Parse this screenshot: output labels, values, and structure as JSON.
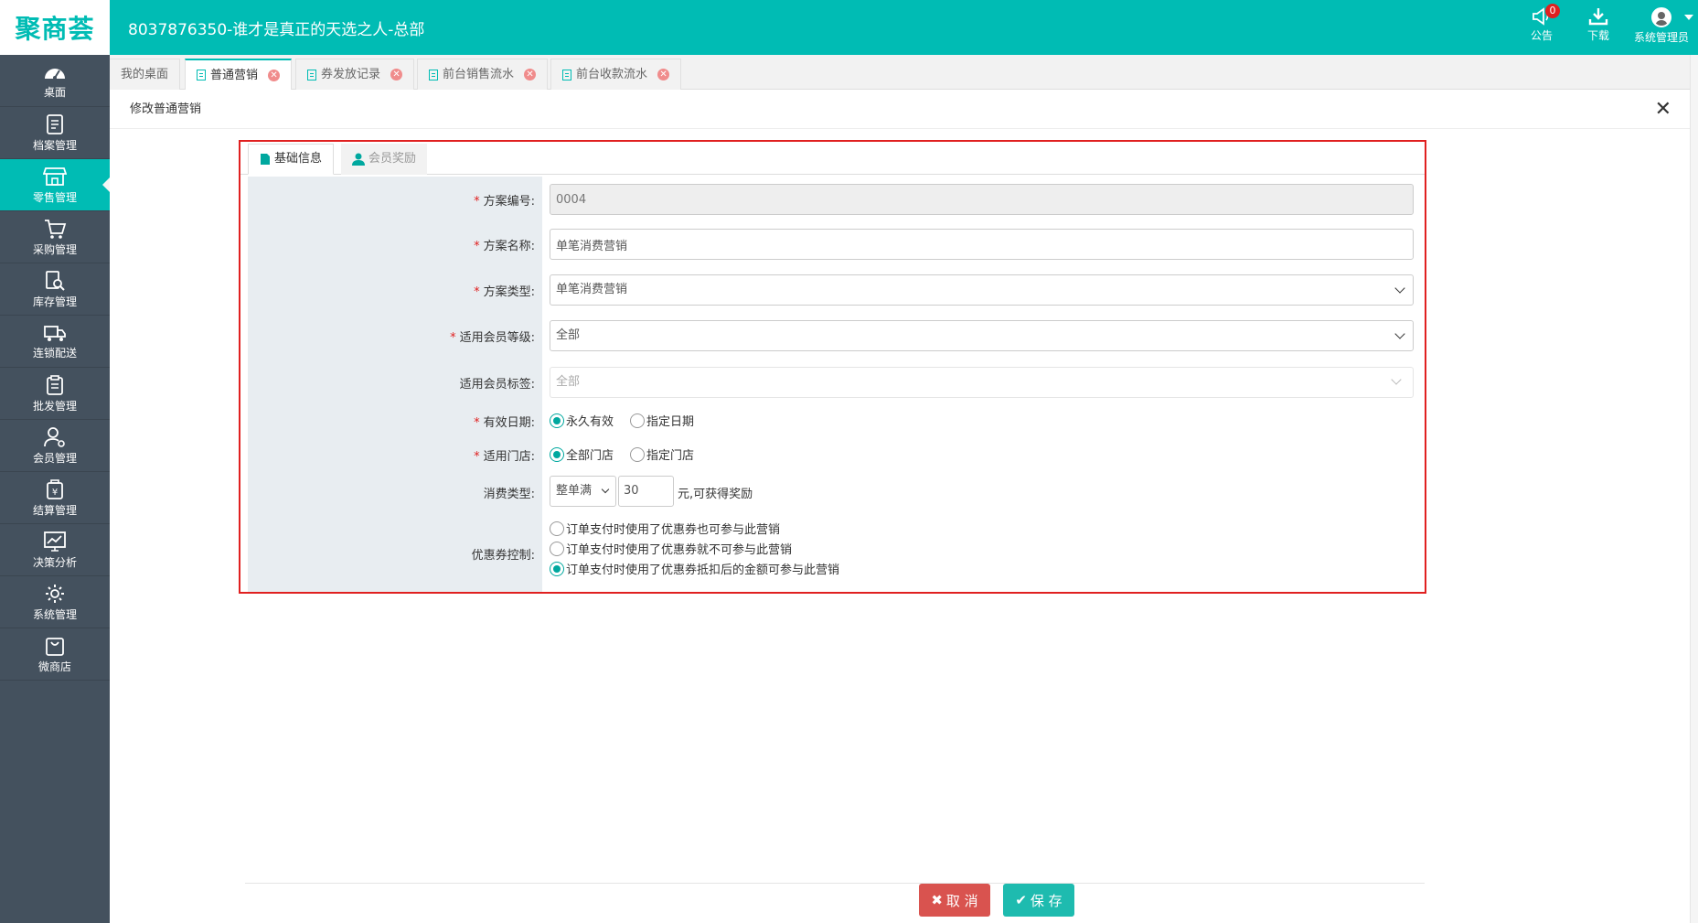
{
  "header": {
    "logo": "聚商荟",
    "title": "8037876350-谁才是真正的天选之人-总部",
    "notice_label": "公告",
    "notice_count": "0",
    "download_label": "下载",
    "user_label": "系统管理员"
  },
  "sidebar": {
    "items": [
      {
        "label": "桌面"
      },
      {
        "label": "档案管理"
      },
      {
        "label": "零售管理"
      },
      {
        "label": "采购管理"
      },
      {
        "label": "库存管理"
      },
      {
        "label": "连锁配送"
      },
      {
        "label": "批发管理"
      },
      {
        "label": "会员管理"
      },
      {
        "label": "结算管理"
      },
      {
        "label": "决策分析"
      },
      {
        "label": "系统管理"
      },
      {
        "label": "微商店"
      }
    ]
  },
  "tabs": [
    {
      "label": "我的桌面"
    },
    {
      "label": "普通营销"
    },
    {
      "label": "券发放记录"
    },
    {
      "label": "前台销售流水"
    },
    {
      "label": "前台收款流水"
    }
  ],
  "page": {
    "title": "修改普通营销",
    "close": "✕"
  },
  "form_tabs": {
    "basic": "基础信息",
    "reward": "会员奖励"
  },
  "form": {
    "code_label": "方案编号:",
    "code_value": "0004",
    "name_label": "方案名称:",
    "name_value": "单笔消费营销",
    "type_label": "方案类型:",
    "type_value": "单笔消费营销",
    "level_label": "适用会员等级:",
    "level_value": "全部",
    "tag_label": "适用会员标签:",
    "tag_value": "全部",
    "date_label": "有效日期:",
    "date_opt1": "永久有效",
    "date_opt2": "指定日期",
    "store_label": "适用门店:",
    "store_opt1": "全部门店",
    "store_opt2": "指定门店",
    "consume_label": "消费类型:",
    "consume_type": "整单满",
    "consume_amount": "30",
    "consume_tail": "元,可获得奖励",
    "coupon_label": "优惠券控制:",
    "coupon_opt1": "订单支付时使用了优惠券也可参与此营销",
    "coupon_opt2": "订单支付时使用了优惠券就不可参与此营销",
    "coupon_opt3": "订单支付时使用了优惠券抵扣后的金额可参与此营销"
  },
  "footer": {
    "cancel": "取 消",
    "save": "保 存"
  },
  "colors": {
    "brand": "#00bcb4",
    "sidebar": "#44515e",
    "cancel": "#d9534f",
    "save": "#1ebbaf",
    "highlight_border": "#e02020"
  }
}
